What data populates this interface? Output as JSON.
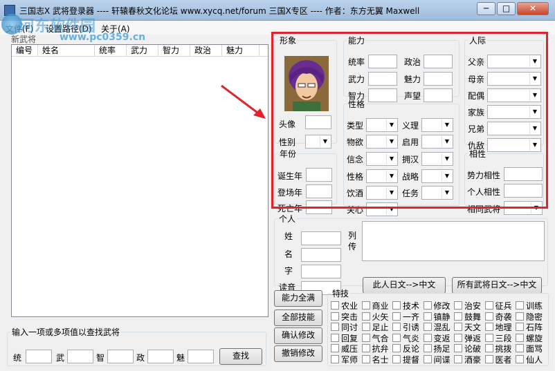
{
  "window": {
    "title": "三国志X 武将登录器  ----  轩辕春秋文化论坛  www.xycq.net/forum  三国X专区  ----  作者：东方无翼  Maxwell",
    "min_glyph": "─",
    "max_glyph": "□",
    "close_glyph": "✕"
  },
  "menu": {
    "file": "文件(F)",
    "path": "设置路径(D)",
    "about": "关于(A)"
  },
  "watermark": {
    "title": "河东软件园",
    "url": "www.pc0359.cn"
  },
  "list": {
    "new_label": "新武将",
    "columns": [
      "编号",
      "姓名",
      "统率",
      "武力",
      "智力",
      "政治",
      "魅力"
    ]
  },
  "search": {
    "legend": "输入一项或多项值以查找武将",
    "labels": [
      "统",
      "武",
      "智",
      "政",
      "魅"
    ],
    "button": "查找"
  },
  "portrait": {
    "legend": "形象",
    "head_label": "头像",
    "gender_label": "性别",
    "colors": {
      "hair": "#6a2c8e",
      "face": "#f2c9a0",
      "bg": "#8a6a3a"
    }
  },
  "year": {
    "legend": "年份",
    "birth": "诞生年",
    "appear": "登场年",
    "death": "死亡年"
  },
  "ability": {
    "legend": "能力",
    "items": [
      "统率",
      "政治",
      "武力",
      "魅力",
      "智力",
      "声望"
    ]
  },
  "personality": {
    "legend": "性格",
    "items": [
      "类型",
      "义理",
      "物欲",
      "启用",
      "信念",
      "拥汉",
      "性格",
      "战略",
      "饮酒",
      "任务",
      "关心"
    ]
  },
  "relations": {
    "legend": "人际",
    "items": [
      "父亲",
      "母亲",
      "配偶",
      "家族",
      "兄弟",
      "仇敌"
    ]
  },
  "affinity": {
    "legend": "相性",
    "items": [
      "势力相性",
      "个人相性",
      "相同武将"
    ]
  },
  "personal": {
    "legend": "个人",
    "items": [
      "姓",
      "名",
      "字",
      "读音"
    ],
    "bio_label": "列传",
    "btn_this": "此人日文-->中文",
    "btn_all": "所有武将日文-->中文"
  },
  "actions": {
    "full": "能力全满",
    "skills": "全部技能",
    "confirm": "确认修改",
    "cancel": "撤销修改"
  },
  "skills": {
    "legend": "特技",
    "rows": [
      [
        "农业",
        "商业",
        "技术",
        "修改",
        "治安",
        "征兵",
        "训练"
      ],
      [
        "突击",
        "火矢",
        "一齐",
        "镇静",
        "鼓舞",
        "奇袭",
        "隐密"
      ],
      [
        "同讨",
        "足止",
        "引诱",
        "混乱",
        "天文",
        "地理",
        "石阵"
      ],
      [
        "回复",
        "气合",
        "气炎",
        "变返",
        "弹返",
        "三段",
        "螺旋"
      ],
      [
        "威压",
        "抗弁",
        "反论",
        "扬足",
        "论破",
        "挑拨",
        "面骂"
      ],
      [
        "军师",
        "名士",
        "提督",
        "间谍",
        "酒豪",
        "医者",
        "仙人"
      ]
    ]
  }
}
